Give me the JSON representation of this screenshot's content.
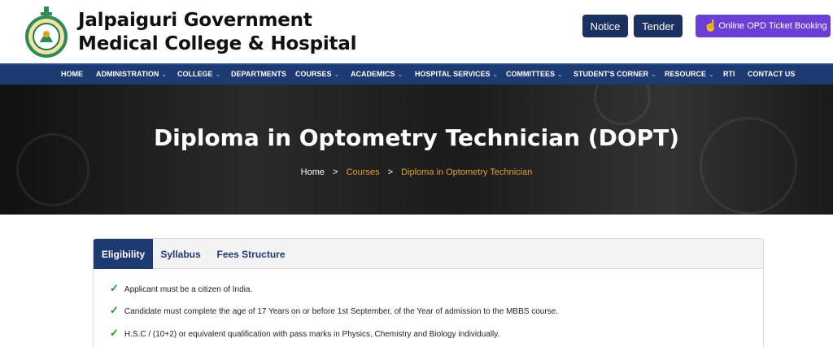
{
  "header": {
    "title_line1": "Jalpaiguri Government",
    "title_line2": "Medical College & Hospital",
    "buttons": {
      "notice": "Notice",
      "tender": "Tender",
      "opd": "Online OPD Ticket Booking"
    }
  },
  "nav": {
    "items": [
      {
        "label": "HOME",
        "dropdown": false
      },
      {
        "label": "ADMINISTRATION",
        "dropdown": true
      },
      {
        "label": "COLLEGE",
        "dropdown": true
      },
      {
        "label": "DEPARTMENTS",
        "dropdown": false
      },
      {
        "label": "COURSES",
        "dropdown": true
      },
      {
        "label": "ACADEMICS",
        "dropdown": true
      },
      {
        "label": "HOSPITAL SERVICES",
        "dropdown": true
      },
      {
        "label": "COMMITTEES",
        "dropdown": true
      },
      {
        "label": "STUDENT'S CORNER",
        "dropdown": true
      },
      {
        "label": "RESOURCE",
        "dropdown": true
      },
      {
        "label": "RTI",
        "dropdown": false
      },
      {
        "label": "CONTACT US",
        "dropdown": false
      }
    ]
  },
  "hero": {
    "title": "Diploma in Optometry Technician (DOPT)",
    "breadcrumb": {
      "home": "Home",
      "sep": ">",
      "courses": "Courses",
      "current": "Diploma in Optometry Technician"
    }
  },
  "tabs": {
    "items": [
      "Eligibility",
      "Syllabus",
      "Fees Structure"
    ],
    "active": "Eligibility"
  },
  "eligibility": {
    "tick": "✓",
    "items": [
      "Applicant must be a citizen of India.",
      "Candidate must complete the age of 17 Years on or before 1st September, of the Year of admission to the MBBS course.",
      "H.S.C / (10+2) or equivalent qualification with pass marks in Physics, Chemistry and Biology individually."
    ]
  },
  "colors": {
    "navy": "#1e3a72",
    "button_navy": "#1d3160",
    "opd_purple": "#6a3fd6",
    "accent_orange": "#e0a030",
    "tick_green": "#1a9a2a"
  }
}
